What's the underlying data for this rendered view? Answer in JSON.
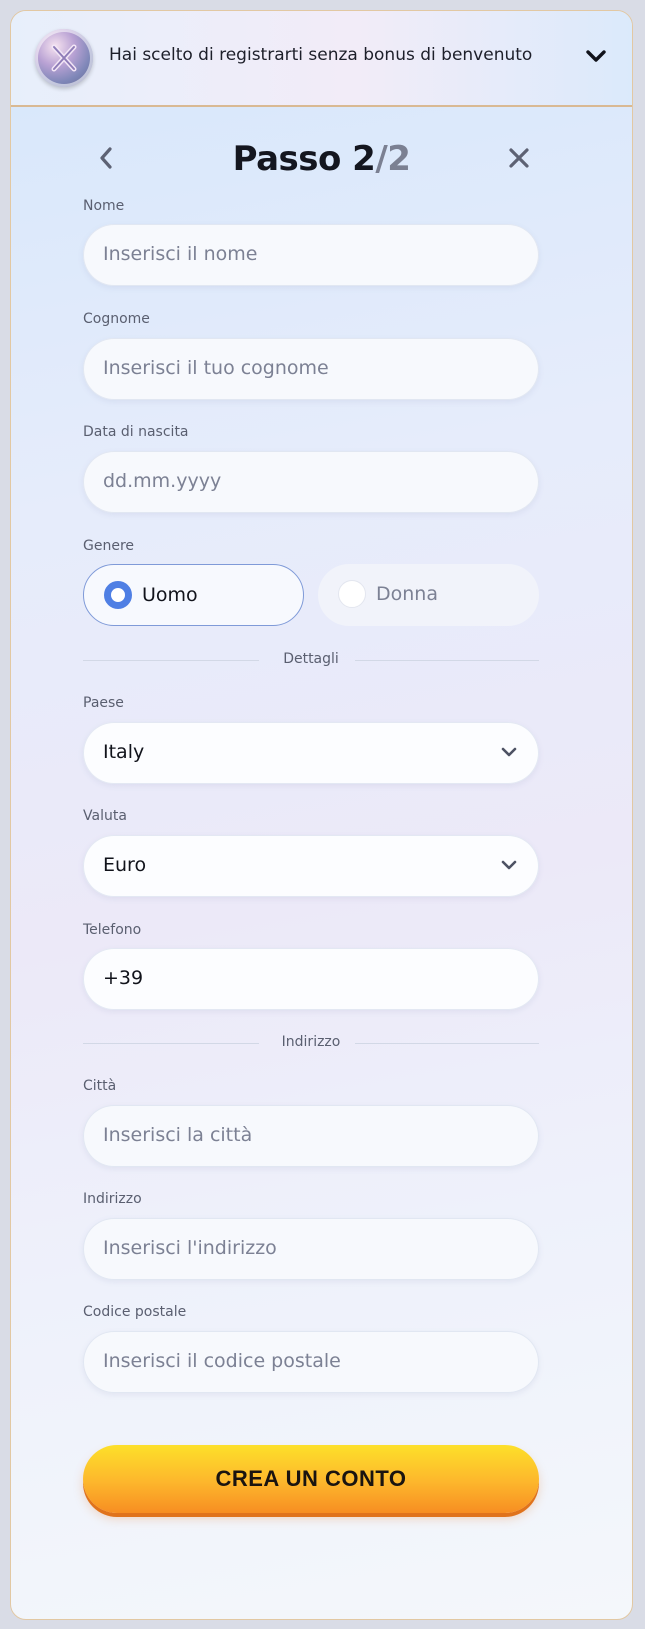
{
  "bonus_bar": {
    "text": "Hai scelto di registrarti senza bonus di benvenuto",
    "icon": "bonus-coin-icon",
    "toggle_icon": "chevron-down-icon"
  },
  "header": {
    "title_prefix": "Passo 2",
    "title_sep": "/",
    "title_total": "2",
    "back_icon": "chevron-left-icon",
    "close_icon": "close-icon"
  },
  "form": {
    "nome": {
      "label": "Nome",
      "placeholder": "Inserisci il nome"
    },
    "cognome": {
      "label": "Cognome",
      "placeholder": "Inserisci il tuo cognome"
    },
    "data_nascita": {
      "label": "Data di nascita",
      "placeholder": "dd.mm.yyyy"
    },
    "genere": {
      "label": "Genere",
      "options": [
        {
          "label": "Uomo",
          "selected": true
        },
        {
          "label": "Donna",
          "selected": false
        }
      ]
    },
    "section_details": "Dettagli",
    "paese": {
      "label": "Paese",
      "value": "Italy"
    },
    "valuta": {
      "label": "Valuta",
      "value": "Euro"
    },
    "telefono": {
      "label": "Telefono",
      "value": "+39"
    },
    "section_address": "Indirizzo",
    "citta": {
      "label": "Città",
      "placeholder": "Inserisci la città"
    },
    "indirizzo": {
      "label": "Indirizzo",
      "placeholder": "Inserisci l'indirizzo"
    },
    "codice_postale": {
      "label": "Codice postale",
      "placeholder": "Inserisci il codice postale"
    },
    "submit_label": "CREA UN CONTO"
  },
  "colors": {
    "accent_radio": "#4f7fe4",
    "cta_top": "#fde02a",
    "cta_bottom": "#f78e22",
    "border_gold": "#d9b993"
  }
}
